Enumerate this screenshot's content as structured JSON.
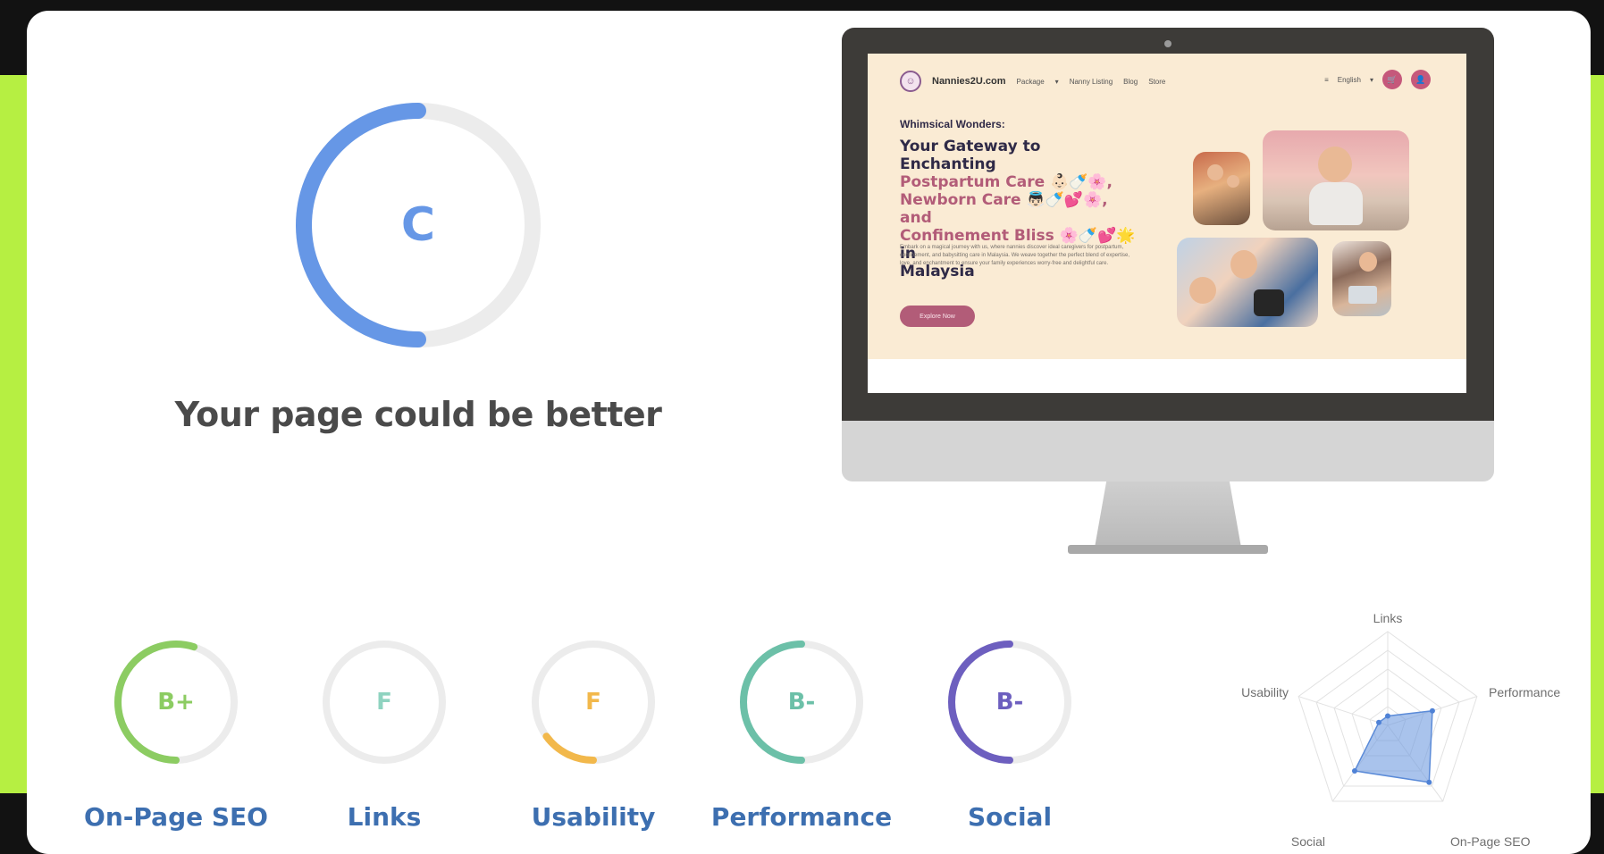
{
  "theme": {
    "accent_lime": "#b6ef42",
    "main_grade_color": "#6697e6",
    "ring_track": "#ececec"
  },
  "summary": {
    "grade": "C",
    "headline": "Your page could be better",
    "ring_fraction": 0.5
  },
  "preview": {
    "logo_text": "Nannies2U.com",
    "nav": [
      "Package",
      "Nanny Listing",
      "Blog",
      "Store"
    ],
    "language": "English",
    "kicker": "Whimsical Wonders:",
    "title_line1": "Your Gateway to Enchanting",
    "title_line2": "Postpartum Care 👶🏻🍼🌸,",
    "title_line3": "Newborn Care 👼🏻🍼💕🌸,",
    "title_and": "and",
    "title_line4": "Confinement Bliss 🌸🍼💕🌟",
    "title_in": "in",
    "title_line5": "Malaysia",
    "body": "Embark on a magical journey with us, where nannies discover ideal caregivers for postpartum, confinement, and babysitting care in Malaysia. We weave together the perfect blend of expertise, love, and enchantment to ensure your family experiences worry-free and delightful care.",
    "cta": "Explore Now"
  },
  "categories": [
    {
      "label": "On-Page SEO",
      "grade": "B+",
      "color": "#8ccc62",
      "fraction": 0.55
    },
    {
      "label": "Links",
      "grade": "F",
      "color": "#8fd3c0",
      "fraction": 0.0
    },
    {
      "label": "Usability",
      "grade": "F",
      "color": "#f2b84b",
      "fraction": 0.15
    },
    {
      "label": "Performance",
      "grade": "B-",
      "color": "#6cc0a8",
      "fraction": 0.5
    },
    {
      "label": "Social",
      "grade": "B-",
      "color": "#6d5fbf",
      "fraction": 0.5
    }
  ],
  "chart_data": {
    "type": "radar",
    "axes": [
      "Links",
      "Performance",
      "On-Page SEO",
      "Social",
      "Usability"
    ],
    "values": [
      0.1,
      0.5,
      0.75,
      0.6,
      0.1
    ],
    "scale_max": 1,
    "fill_color": "#6f9be0"
  }
}
